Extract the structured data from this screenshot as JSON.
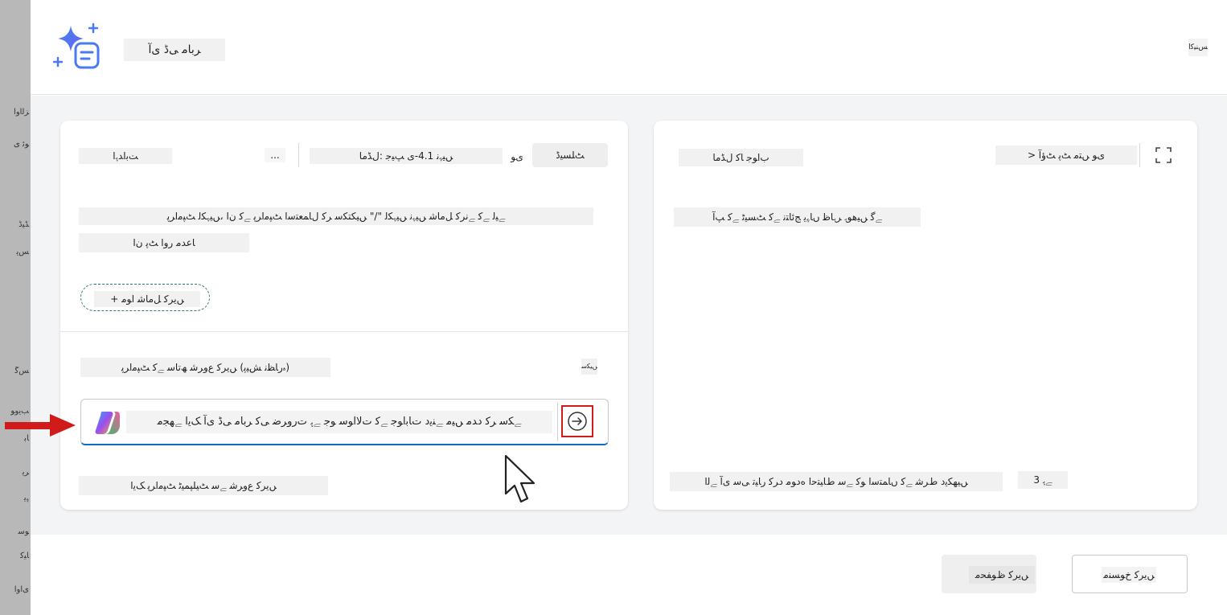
{
  "background": {
    "items": [
      "ﺰﻟاوا",
      "ﻮﺋ ﯼ",
      "ﮉﯿڈ",
      "ﺲﯾ",
      "ﺲﮔ",
      "ﺐﯾوﻮ",
      "ﺎﺑ",
      "ﺮﯾ",
      "ﮩﯾ",
      "ﻮﺳ",
      "ﺎﯿﮐ",
      "ﯼاوﺍ"
    ]
  },
  "header": {
    "title": "ﺮﺑﺎﻣ ﯽڈ ﯼﺁ",
    "close_label": "ﺲﻨﯿﻛا"
  },
  "left_panel": {
    "data_label": "ﺖﺑﺍﺪﮨﺍ",
    "more_label": "...",
    "model_label": "ﮟﯿﮩﻧ 4.1-ﯼ ﭗﯿﺟ :ﻝﮉﻣﺎ",
    "model_suffix": "ﯼﻮ",
    "default_label": "ﭧﻠﺴﯿڈ",
    "instructions_line1": "ﮯﯿﻟ ﮯﮐ ﮯﻧﺮﮐ ﻞﻣﺎﺷ ﮟﯿﮩﻧ ﮟﯿﮩﮑﻟ \"/\" ﮟﯿﮑﺘﮑﺳ ﺮﮐ ﻝﺎﻤﻌﺘﺳﺍ ﭧﭙﻣﺍﺮﭘ ﮯﮐ ﻥﺍ ،ﮟﯿﮩﮑﻟ ﭧﭙﻣﺍﺮﭘ",
    "instructions_line2": "ﺎﻋﺪﻣ ﺭﻭﺍ ﭧﭘ ﻥﺍ",
    "add_variable_label": "ﮟﯾﺮﮐ ﻞﻣﺎﺷ ﺍﻮﻣ +",
    "prompt_section_label": "(ﮦﺭﺎﻈﻧ ﺶﯿﭘ) ﮟﯾﺮﮐ ﻉﻭﺮﺷ ﮫﺗﺎﺳ ﮯﮐ ﭧﭙﻣﺍﺮﭘ",
    "prompt_side_label": "ﮟﯿﮑﺳ",
    "input_value": "ﮯﮑﺳ ﺮﮐ ﺩﺪﻣ ﮟﯿﻣ ﮯﻨﯾﺩ ﺕﺎﺑﺍﻮﺟ ﮯﮐ ﺕﻻﺍﻮﺳ ﻮﺟ ﮯﮨ ﺕﺭﻭﺮﺿ ﯽﮐ ﺮﺑﺎﻣ ﯽڈ ﯼﺁ ﮏﯾﺍ ﮯﮭﺠﻣ",
    "footer_hint": "ﮟﯾﺮﮐ ﻉﻭﺮﺷ ﮯﺳ ﭧﯿﻠﭙﻤﯿﭨ ﭧﭙﻣﺍﺮﭘ ﮏﯾﺍ"
  },
  "right_panel": {
    "title": "ﺏﺍﻮﺟ ﺎﮐ ﻝﮉﻣﺎ",
    "output_toggle": "ﯼﻮ ﮟﺘﻣ ﭧﭘ ﭧﺅﺁ <",
    "placeholder": "ﮯﮔ ﮟﯿﻫﻮﮨ ﺮﮨﺎﻇ ﮞﺎﮩﯾ ﺞﺋﺎﺘﻧ ﮯﮐ ﭧﺴﯿﭨ ﮯﮐ ﭗﺁ",
    "disclaimer": "ﮟﯿﮭﮑﯾﺩ ﻁﺮﺷ ﮯﮐ ﮞﺎﻤﺘﺳﺍ ﻮﮐ ﮯﺳ ﻁﺎﯿﺘﺣﺍ ﻩﺩﻮﻣ ﺩﺮﮐ ﺭﺎﯿﺗ ﯽﺳ ﯼﺁ ﮯﻟﺍ",
    "count_label": "ﮯﮨ 3"
  },
  "footer": {
    "save_label": "ﮟﯾﺮﮐ ﻅﻮﻔﺤﻣ",
    "cancel_label": "ﮟﯾﺮﮐ ﺥﻮﺴﻨﻣ"
  },
  "colors": {
    "accent": "#0f6cbd",
    "highlight_red": "#d11a1a",
    "teal_border": "#2e7d7d"
  }
}
